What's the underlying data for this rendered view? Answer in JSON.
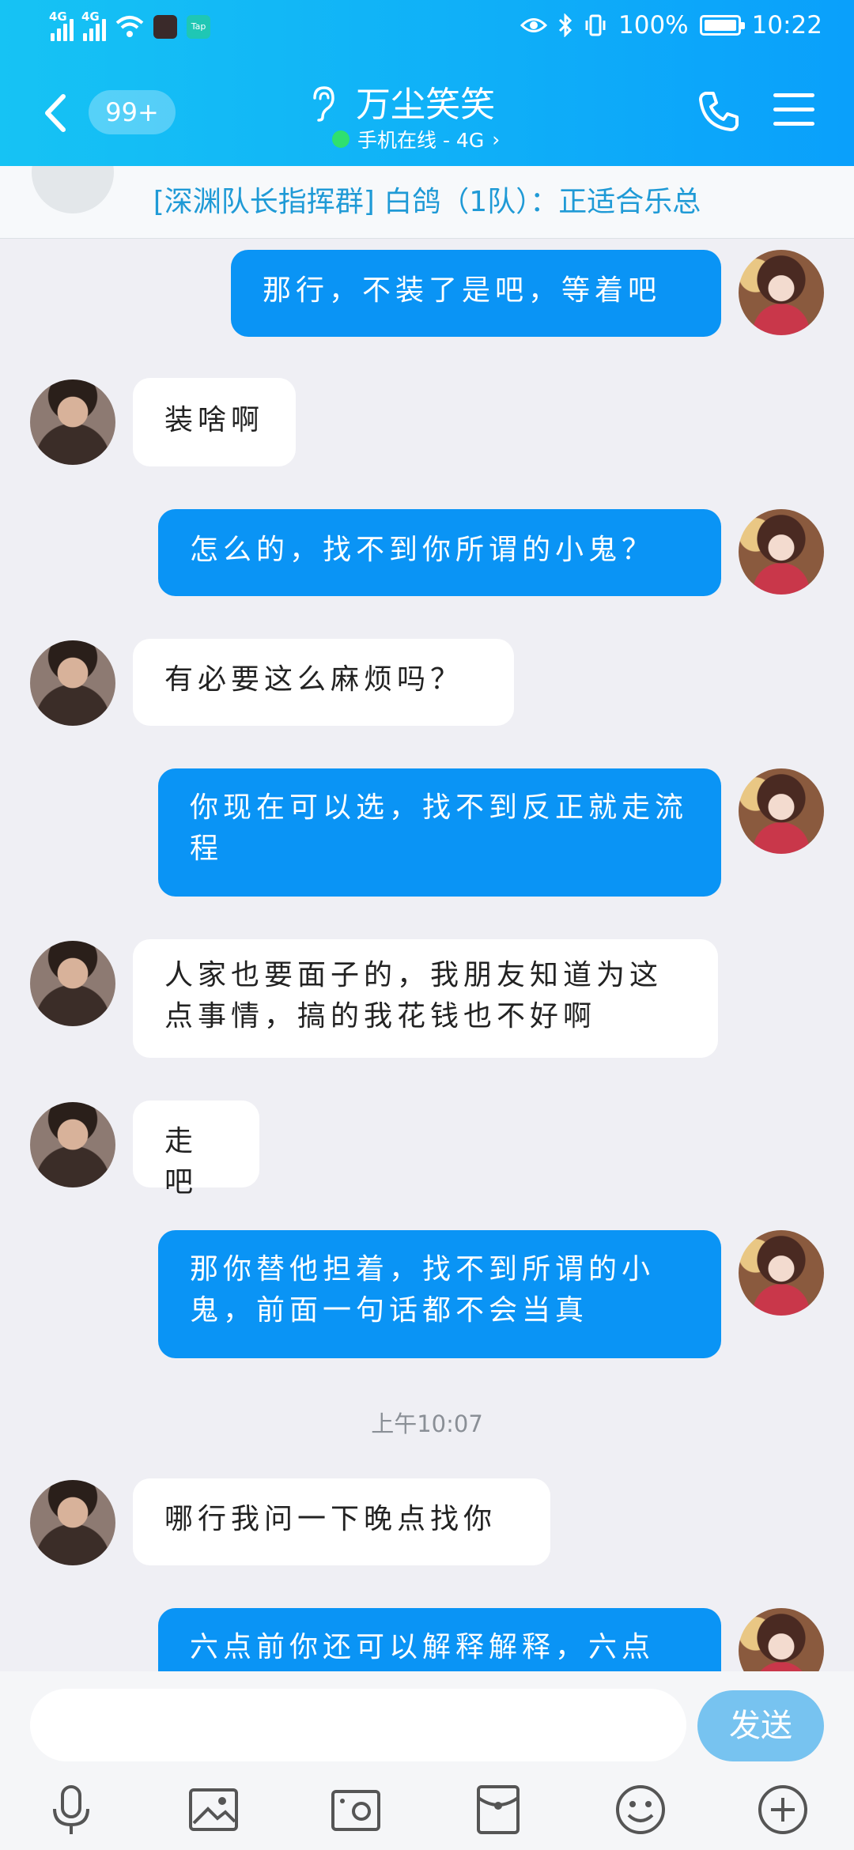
{
  "status_bar": {
    "net1": "4G",
    "net2": "4G",
    "app_badge": "Tap",
    "battery": "100%",
    "time": "10:22"
  },
  "header": {
    "unread_badge": "99+",
    "contact_name": "万尘笑笑",
    "status": "手机在线 - 4G"
  },
  "notice": {
    "text": "[深渊队长指挥群] 白鸽（1队）：正适合乐总"
  },
  "messages": [
    {
      "from": "me",
      "text": "那行，不装了是吧，等着吧"
    },
    {
      "from": "other",
      "text": "装啥啊"
    },
    {
      "from": "me",
      "text": "怎么的，找不到你所谓的小鬼？"
    },
    {
      "from": "other",
      "text": "有必要这么麻烦吗？"
    },
    {
      "from": "me",
      "text": "你现在可以选，找不到反正就走流程"
    },
    {
      "from": "other",
      "text": "人家也要面子的，我朋友知道为这点事情，搞的我花钱也不好啊"
    },
    {
      "from": "other",
      "text": "走吧"
    },
    {
      "from": "me",
      "text": "那你替他担着，找不到所谓的小鬼，前面一句话都不会当真"
    },
    {
      "from": "other",
      "text": "哪行我问一下晚点找你"
    },
    {
      "from": "me",
      "text": "六点前你还可以解释解释，六点"
    }
  ],
  "timestamp": "上午10:07",
  "input": {
    "placeholder": "",
    "send_label": "发送"
  },
  "toolbar": [
    "microphone-icon",
    "image-icon",
    "camera-icon",
    "red-packet-icon",
    "emoji-icon",
    "plus-icon"
  ]
}
